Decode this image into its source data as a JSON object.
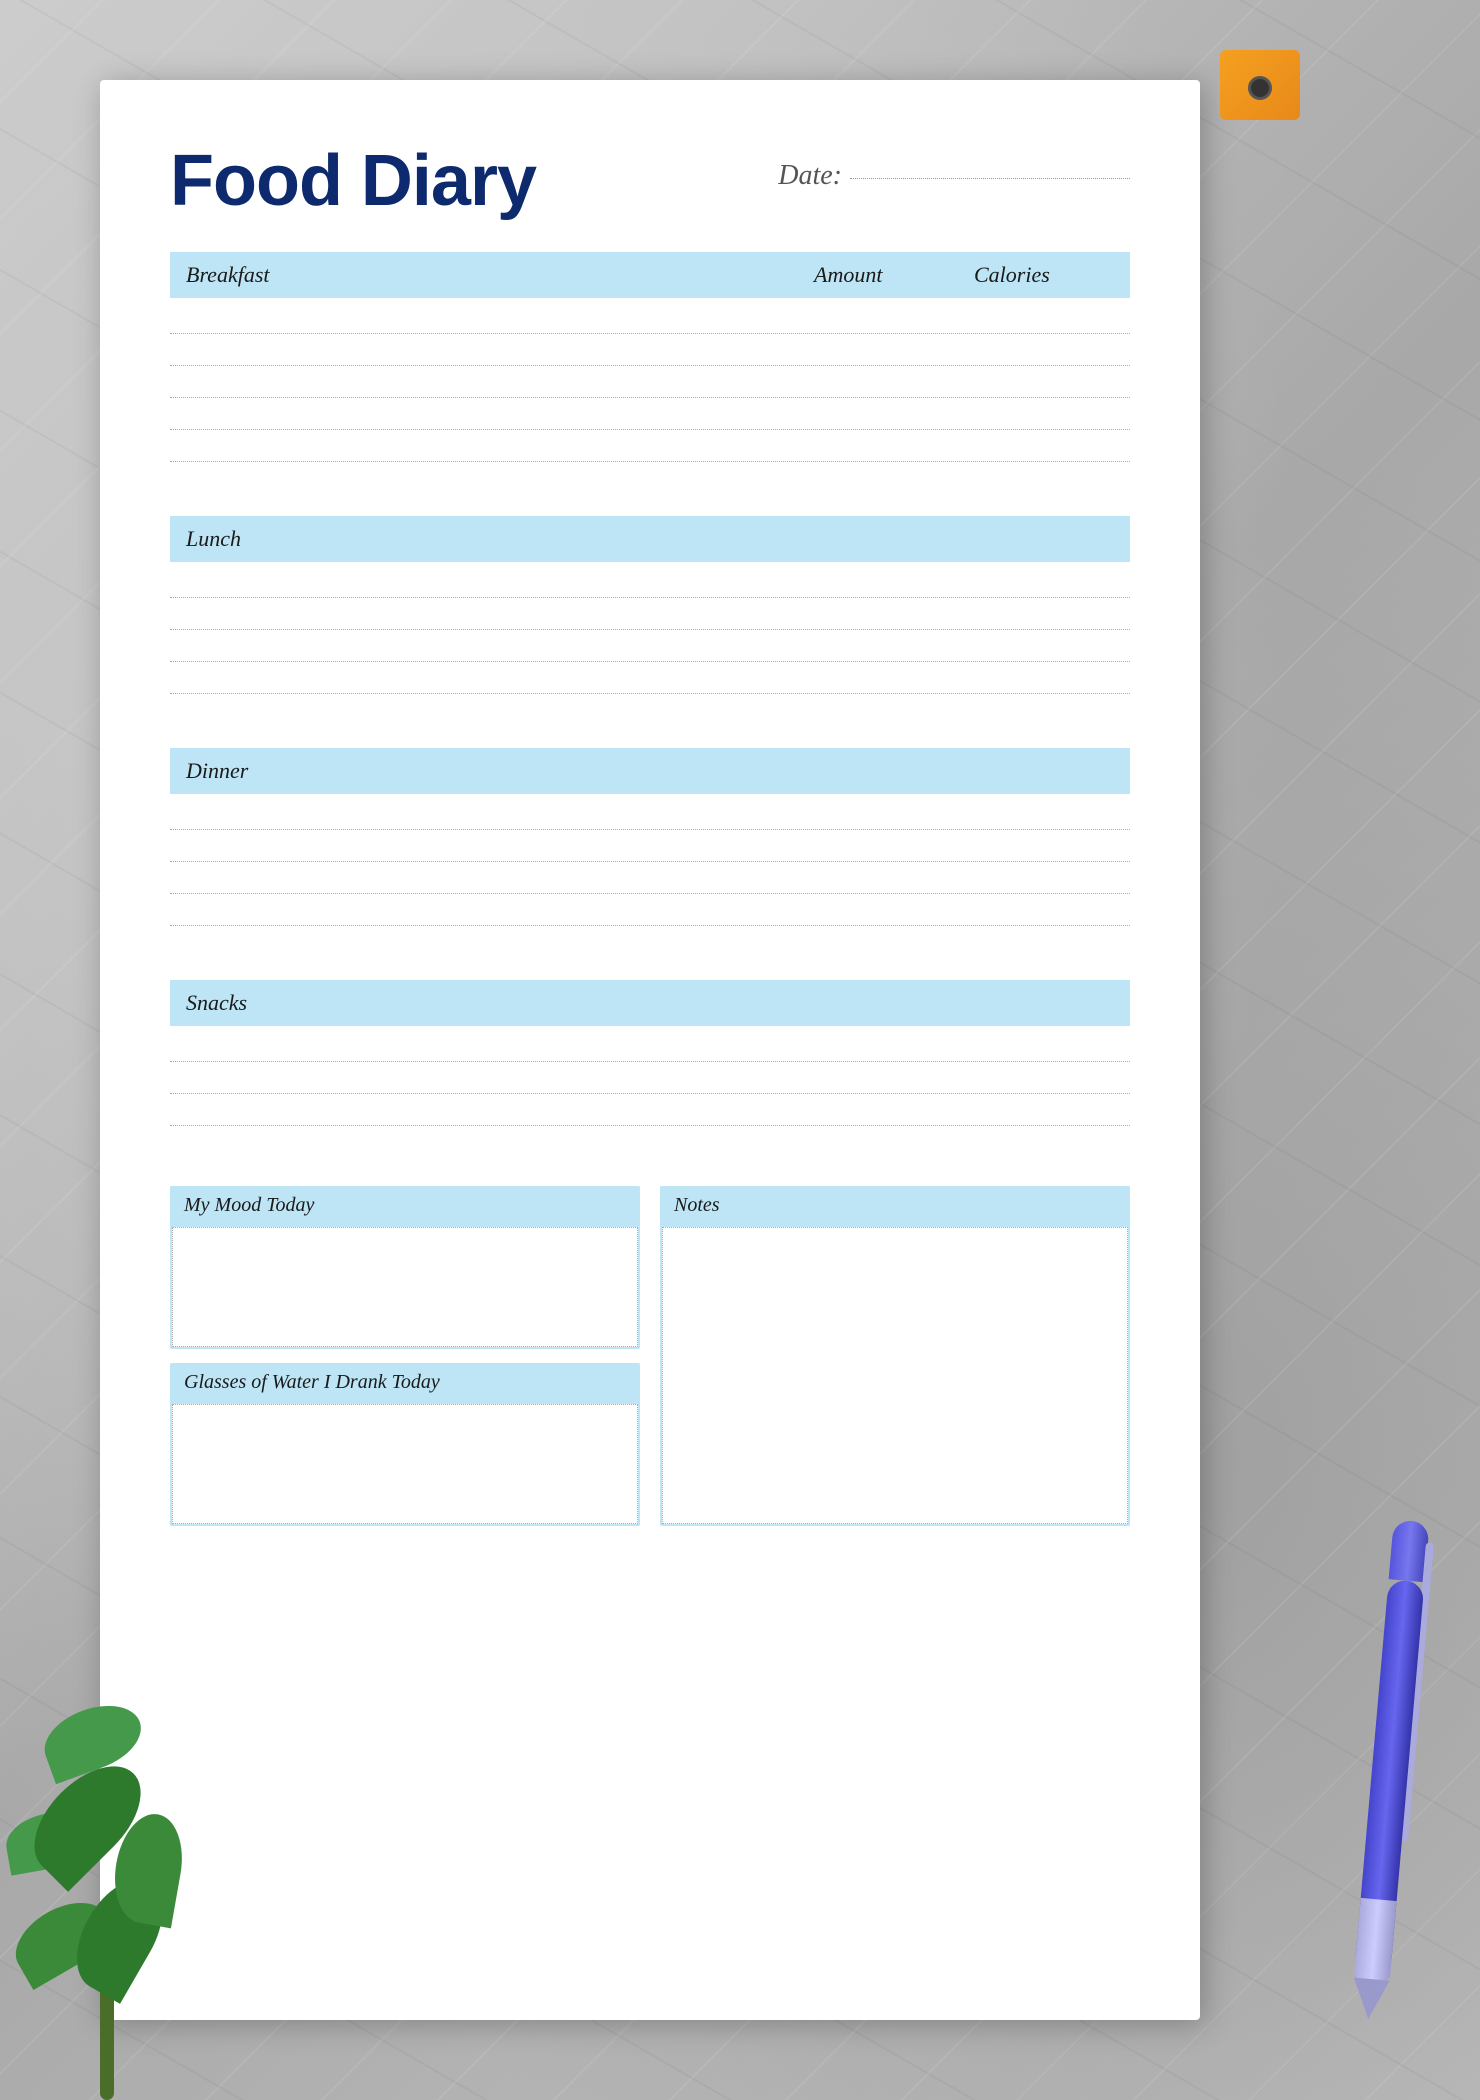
{
  "page": {
    "title": "Food Diary",
    "date_label": "Date:",
    "background_color": "#c8c8c8"
  },
  "sections": {
    "breakfast": {
      "label": "Breakfast",
      "amount_col": "Amount",
      "calories_col": "Calories",
      "rows": 6
    },
    "lunch": {
      "label": "Lunch",
      "rows": 5
    },
    "dinner": {
      "label": "Dinner",
      "rows": 5
    },
    "snacks": {
      "label": "Snacks",
      "rows": 4
    }
  },
  "bottom": {
    "mood_label": "My Mood Today",
    "water_label": "Glasses of Water I Drank Today",
    "notes_label": "Notes"
  },
  "colors": {
    "title": "#0d2a6e",
    "section_bg": "#bde5f5",
    "paper_bg": "#ffffff"
  }
}
